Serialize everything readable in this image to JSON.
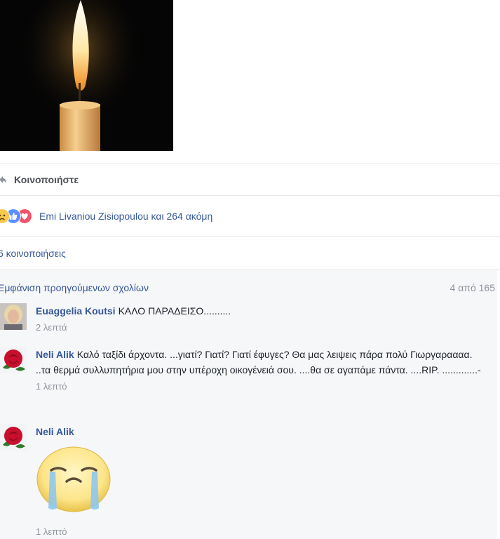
{
  "post": {
    "image_icon": "candle-icon",
    "share_label": "Κοινοποιήστε",
    "reactions": {
      "icons": [
        "sad-reaction-icon",
        "like-reaction-icon",
        "love-reaction-icon"
      ],
      "names_text": "Emi Livaniou Zisiopoulou και 264 ακόμη"
    },
    "shares_text": "6 κοινοποιήσεις"
  },
  "comments": {
    "previous_link": "Εμφάνιση προηγούμενων σχολίων",
    "count_text": "4 από 165",
    "items": [
      {
        "author": "Euaggelia Koutsi",
        "text": "ΚΑΛΟ ΠΑΡΑΔΕΙΣΟ..........",
        "time": "2 λεπτά"
      },
      {
        "author": "Neli Alik",
        "text": "Καλό ταξίδι άρχοντα. ...γιατί? Γιατί? Γιατί έφυγες? Θα μας λειψεις πάρα πολύ Γιωργαραααα. ..τα θερμά συλλυπητήρια μου στην υπέροχη οικογένειά σου. ....θα σε αγαπάμε πάντα. ....RIP. .............-",
        "time": "1 λεπτό"
      },
      {
        "author": "Neli Alik",
        "text": "",
        "sticker": "crying-face-sticker",
        "time": "1 λεπτό"
      }
    ]
  },
  "colors": {
    "link": "#365899",
    "muted": "#90949c",
    "comment_bg": "#f6f7f9",
    "like_blue": "#5890ff",
    "love_red": "#f25268",
    "sad_yellow": "#f7c949"
  }
}
